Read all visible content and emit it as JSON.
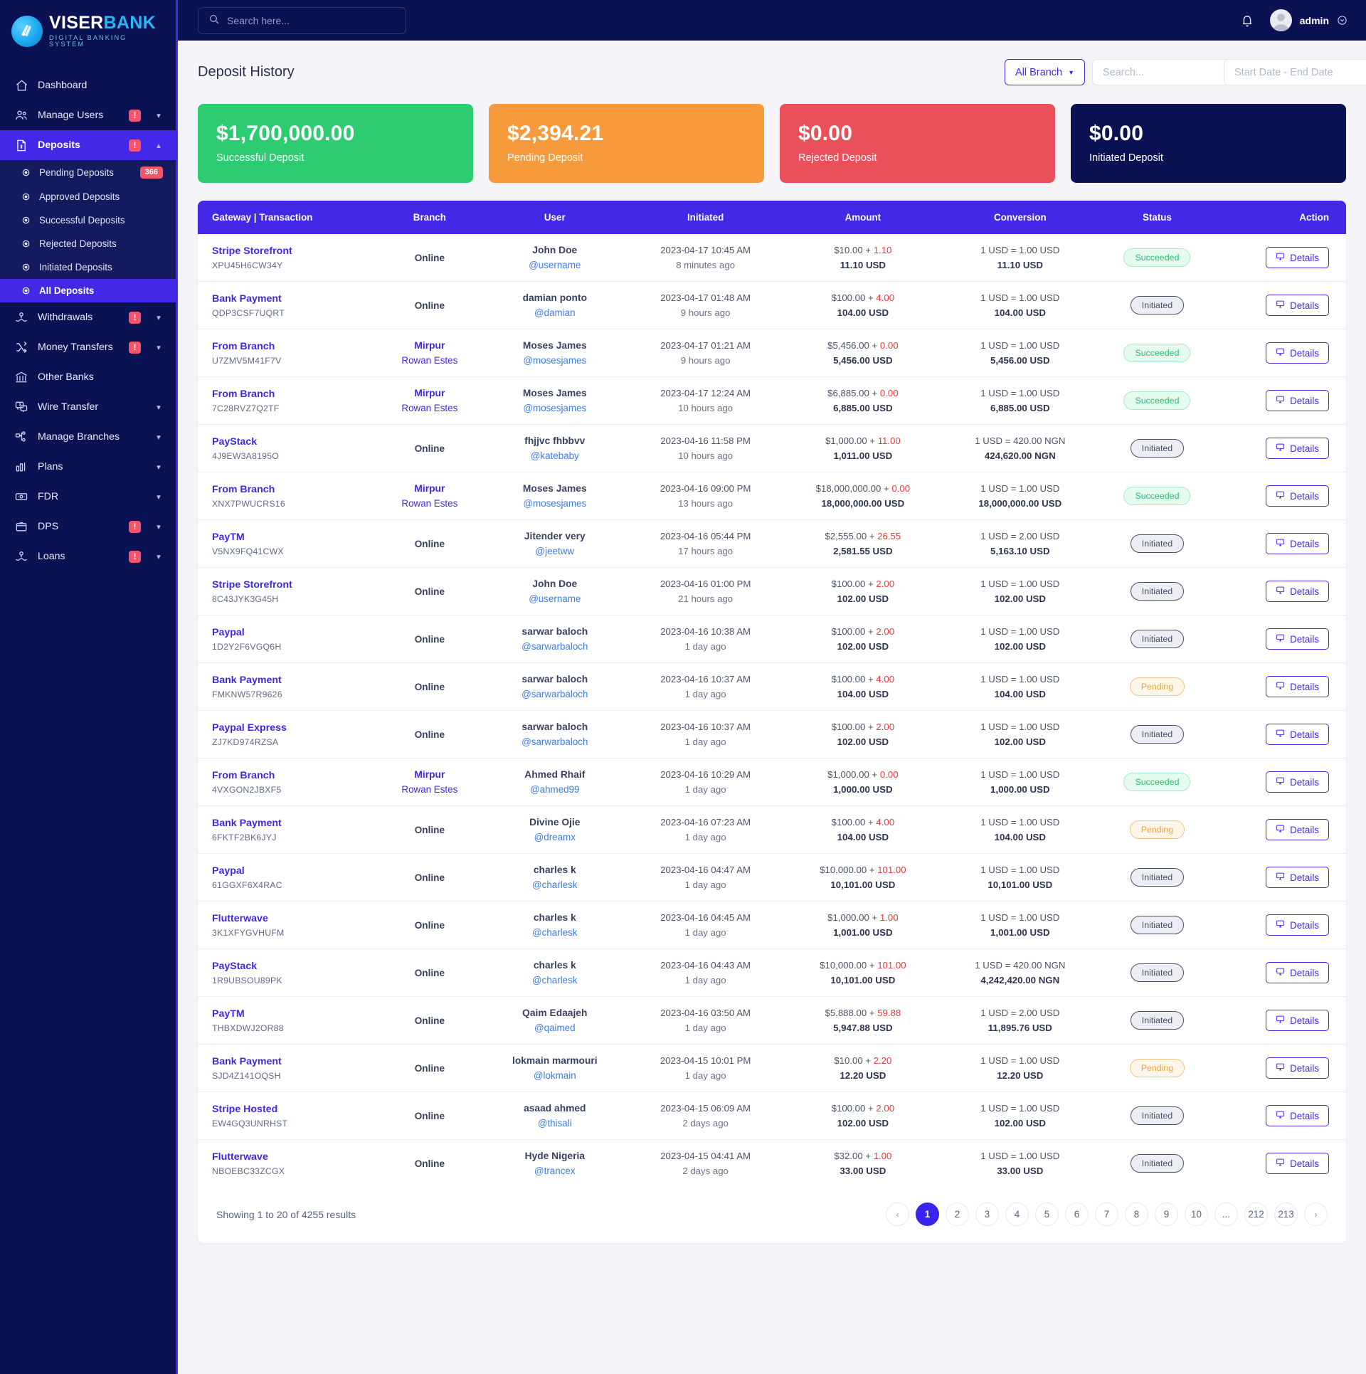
{
  "brand": {
    "word1": "VISER",
    "word2": "BANK",
    "subtitle": "DIGITAL BANKING SYSTEM"
  },
  "topbar": {
    "search_placeholder": "Search here...",
    "search_value": "",
    "username": "admin"
  },
  "sidebar": {
    "items": [
      {
        "label": "Dashboard",
        "icon": "home-icon",
        "alert": false,
        "chevron": ""
      },
      {
        "label": "Manage Users",
        "icon": "users-icon",
        "alert": true,
        "chevron": "down"
      },
      {
        "label": "Deposits",
        "icon": "deposit-icon",
        "alert": true,
        "chevron": "up",
        "active": true
      },
      {
        "label": "Withdrawals",
        "icon": "withdraw-icon",
        "alert": true,
        "chevron": "down"
      },
      {
        "label": "Money Transfers",
        "icon": "transfer-icon",
        "alert": true,
        "chevron": "down"
      },
      {
        "label": "Other Banks",
        "icon": "bank-icon",
        "alert": false,
        "chevron": ""
      },
      {
        "label": "Wire Transfer",
        "icon": "wire-icon",
        "alert": false,
        "chevron": "down"
      },
      {
        "label": "Manage Branches",
        "icon": "branch-icon",
        "alert": false,
        "chevron": "down"
      },
      {
        "label": "Plans",
        "icon": "plans-icon",
        "alert": false,
        "chevron": "down"
      },
      {
        "label": "FDR",
        "icon": "fdr-icon",
        "alert": false,
        "chevron": "down"
      },
      {
        "label": "DPS",
        "icon": "dps-icon",
        "alert": true,
        "chevron": "down"
      },
      {
        "label": "Loans",
        "icon": "loans-icon",
        "alert": true,
        "chevron": "down"
      }
    ],
    "subitems": [
      {
        "label": "Pending Deposits",
        "count": "366"
      },
      {
        "label": "Approved Deposits",
        "count": ""
      },
      {
        "label": "Successful Deposits",
        "count": ""
      },
      {
        "label": "Rejected Deposits",
        "count": ""
      },
      {
        "label": "Initiated Deposits",
        "count": ""
      },
      {
        "label": "All Deposits",
        "count": "",
        "active": true
      }
    ]
  },
  "page": {
    "title": "Deposit History",
    "branch_filter": "All Branch",
    "search_placeholder": "Search...",
    "search_value": "",
    "date_placeholder": "Start Date - End Date",
    "date_value": ""
  },
  "cards": [
    {
      "value": "$1,700,000.00",
      "label": "Successful Deposit",
      "color": "#2ecc71"
    },
    {
      "value": "$2,394.21",
      "label": "Pending Deposit",
      "color": "#f79a3c"
    },
    {
      "value": "$0.00",
      "label": "Rejected Deposit",
      "color": "#e9505a"
    },
    {
      "value": "$0.00",
      "label": "Initiated Deposit",
      "color": "#0a1253"
    }
  ],
  "table": {
    "columns": [
      "Gateway | Transaction",
      "Branch",
      "User",
      "Initiated",
      "Amount",
      "Conversion",
      "Status",
      "Action"
    ],
    "details_label": "Details",
    "rows": [
      {
        "gateway": "Stripe Storefront",
        "trx": "XPU45H6CW34Y",
        "branch": "Online",
        "branch_sub": "",
        "user": "John Doe",
        "handle": "@username",
        "date": "2023-04-17 10:45 AM",
        "ago": "8 minutes ago",
        "amount": "$10.00 + ",
        "fee": "1.10",
        "total": "11.10 USD",
        "rate": "1 USD = 1.00 USD",
        "converted": "11.10 USD",
        "status": "Succeeded"
      },
      {
        "gateway": "Bank Payment",
        "trx": "QDP3CSF7UQRT",
        "branch": "Online",
        "branch_sub": "",
        "user": "damian ponto",
        "handle": "@damian",
        "date": "2023-04-17 01:48 AM",
        "ago": "9 hours ago",
        "amount": "$100.00 + ",
        "fee": "4.00",
        "total": "104.00 USD",
        "rate": "1 USD = 1.00 USD",
        "converted": "104.00 USD",
        "status": "Initiated"
      },
      {
        "gateway": "From Branch",
        "trx": "U7ZMV5M41F7V",
        "branch": "Mirpur",
        "branch_sub": "Rowan Estes",
        "user": "Moses James",
        "handle": "@mosesjames",
        "date": "2023-04-17 01:21 AM",
        "ago": "9 hours ago",
        "amount": "$5,456.00 + ",
        "fee": "0.00",
        "total": "5,456.00 USD",
        "rate": "1 USD = 1.00 USD",
        "converted": "5,456.00 USD",
        "status": "Succeeded"
      },
      {
        "gateway": "From Branch",
        "trx": "7C28RVZ7Q2TF",
        "branch": "Mirpur",
        "branch_sub": "Rowan Estes",
        "user": "Moses James",
        "handle": "@mosesjames",
        "date": "2023-04-17 12:24 AM",
        "ago": "10 hours ago",
        "amount": "$6,885.00 + ",
        "fee": "0.00",
        "total": "6,885.00 USD",
        "rate": "1 USD = 1.00 USD",
        "converted": "6,885.00 USD",
        "status": "Succeeded"
      },
      {
        "gateway": "PayStack",
        "trx": "4J9EW3A8195O",
        "branch": "Online",
        "branch_sub": "",
        "user": "fhjjvc fhbbvv",
        "handle": "@katebaby",
        "date": "2023-04-16 11:58 PM",
        "ago": "10 hours ago",
        "amount": "$1,000.00 + ",
        "fee": "11.00",
        "total": "1,011.00 USD",
        "rate": "1 USD = 420.00 NGN",
        "converted": "424,620.00 NGN",
        "status": "Initiated"
      },
      {
        "gateway": "From Branch",
        "trx": "XNX7PWUCRS16",
        "branch": "Mirpur",
        "branch_sub": "Rowan Estes",
        "user": "Moses James",
        "handle": "@mosesjames",
        "date": "2023-04-16 09:00 PM",
        "ago": "13 hours ago",
        "amount": "$18,000,000.00 + ",
        "fee": "0.00",
        "total": "18,000,000.00 USD",
        "rate": "1 USD = 1.00 USD",
        "converted": "18,000,000.00 USD",
        "status": "Succeeded"
      },
      {
        "gateway": "PayTM",
        "trx": "V5NX9FQ41CWX",
        "branch": "Online",
        "branch_sub": "",
        "user": "Jitender very",
        "handle": "@jeetww",
        "date": "2023-04-16 05:44 PM",
        "ago": "17 hours ago",
        "amount": "$2,555.00 + ",
        "fee": "26.55",
        "total": "2,581.55 USD",
        "rate": "1 USD = 2.00 USD",
        "converted": "5,163.10 USD",
        "status": "Initiated"
      },
      {
        "gateway": "Stripe Storefront",
        "trx": "8C43JYK3G45H",
        "branch": "Online",
        "branch_sub": "",
        "user": "John Doe",
        "handle": "@username",
        "date": "2023-04-16 01:00 PM",
        "ago": "21 hours ago",
        "amount": "$100.00 + ",
        "fee": "2.00",
        "total": "102.00 USD",
        "rate": "1 USD = 1.00 USD",
        "converted": "102.00 USD",
        "status": "Initiated"
      },
      {
        "gateway": "Paypal",
        "trx": "1D2Y2F6VGQ6H",
        "branch": "Online",
        "branch_sub": "",
        "user": "sarwar baloch",
        "handle": "@sarwarbaloch",
        "date": "2023-04-16 10:38 AM",
        "ago": "1 day ago",
        "amount": "$100.00 + ",
        "fee": "2.00",
        "total": "102.00 USD",
        "rate": "1 USD = 1.00 USD",
        "converted": "102.00 USD",
        "status": "Initiated"
      },
      {
        "gateway": "Bank Payment",
        "trx": "FMKNW57R9626",
        "branch": "Online",
        "branch_sub": "",
        "user": "sarwar baloch",
        "handle": "@sarwarbaloch",
        "date": "2023-04-16 10:37 AM",
        "ago": "1 day ago",
        "amount": "$100.00 + ",
        "fee": "4.00",
        "total": "104.00 USD",
        "rate": "1 USD = 1.00 USD",
        "converted": "104.00 USD",
        "status": "Pending"
      },
      {
        "gateway": "Paypal Express",
        "trx": "ZJ7KD974RZSA",
        "branch": "Online",
        "branch_sub": "",
        "user": "sarwar baloch",
        "handle": "@sarwarbaloch",
        "date": "2023-04-16 10:37 AM",
        "ago": "1 day ago",
        "amount": "$100.00 + ",
        "fee": "2.00",
        "total": "102.00 USD",
        "rate": "1 USD = 1.00 USD",
        "converted": "102.00 USD",
        "status": "Initiated"
      },
      {
        "gateway": "From Branch",
        "trx": "4VXGON2JBXF5",
        "branch": "Mirpur",
        "branch_sub": "Rowan Estes",
        "user": "Ahmed Rhaif",
        "handle": "@ahmed99",
        "date": "2023-04-16 10:29 AM",
        "ago": "1 day ago",
        "amount": "$1,000.00 + ",
        "fee": "0.00",
        "total": "1,000.00 USD",
        "rate": "1 USD = 1.00 USD",
        "converted": "1,000.00 USD",
        "status": "Succeeded"
      },
      {
        "gateway": "Bank Payment",
        "trx": "6FKTF2BK6JYJ",
        "branch": "Online",
        "branch_sub": "",
        "user": "Divine Ojie",
        "handle": "@dreamx",
        "date": "2023-04-16 07:23 AM",
        "ago": "1 day ago",
        "amount": "$100.00 + ",
        "fee": "4.00",
        "total": "104.00 USD",
        "rate": "1 USD = 1.00 USD",
        "converted": "104.00 USD",
        "status": "Pending"
      },
      {
        "gateway": "Paypal",
        "trx": "61GGXF6X4RAC",
        "branch": "Online",
        "branch_sub": "",
        "user": "charles k",
        "handle": "@charlesk",
        "date": "2023-04-16 04:47 AM",
        "ago": "1 day ago",
        "amount": "$10,000.00 + ",
        "fee": "101.00",
        "total": "10,101.00 USD",
        "rate": "1 USD = 1.00 USD",
        "converted": "10,101.00 USD",
        "status": "Initiated"
      },
      {
        "gateway": "Flutterwave",
        "trx": "3K1XFYGVHUFM",
        "branch": "Online",
        "branch_sub": "",
        "user": "charles k",
        "handle": "@charlesk",
        "date": "2023-04-16 04:45 AM",
        "ago": "1 day ago",
        "amount": "$1,000.00 + ",
        "fee": "1.00",
        "total": "1,001.00 USD",
        "rate": "1 USD = 1.00 USD",
        "converted": "1,001.00 USD",
        "status": "Initiated"
      },
      {
        "gateway": "PayStack",
        "trx": "1R9UBSOU89PK",
        "branch": "Online",
        "branch_sub": "",
        "user": "charles k",
        "handle": "@charlesk",
        "date": "2023-04-16 04:43 AM",
        "ago": "1 day ago",
        "amount": "$10,000.00 + ",
        "fee": "101.00",
        "total": "10,101.00 USD",
        "rate": "1 USD = 420.00 NGN",
        "converted": "4,242,420.00 NGN",
        "status": "Initiated"
      },
      {
        "gateway": "PayTM",
        "trx": "THBXDWJ2OR88",
        "branch": "Online",
        "branch_sub": "",
        "user": "Qaim Edaajeh",
        "handle": "@qaimed",
        "date": "2023-04-16 03:50 AM",
        "ago": "1 day ago",
        "amount": "$5,888.00 + ",
        "fee": "59.88",
        "total": "5,947.88 USD",
        "rate": "1 USD = 2.00 USD",
        "converted": "11,895.76 USD",
        "status": "Initiated"
      },
      {
        "gateway": "Bank Payment",
        "trx": "SJD4Z141OQSH",
        "branch": "Online",
        "branch_sub": "",
        "user": "lokmain marmouri",
        "handle": "@lokmain",
        "date": "2023-04-15 10:01 PM",
        "ago": "1 day ago",
        "amount": "$10.00 + ",
        "fee": "2.20",
        "total": "12.20 USD",
        "rate": "1 USD = 1.00 USD",
        "converted": "12.20 USD",
        "status": "Pending"
      },
      {
        "gateway": "Stripe Hosted",
        "trx": "EW4GQ3UNRHST",
        "branch": "Online",
        "branch_sub": "",
        "user": "asaad ahmed",
        "handle": "@thisali",
        "date": "2023-04-15 06:09 AM",
        "ago": "2 days ago",
        "amount": "$100.00 + ",
        "fee": "2.00",
        "total": "102.00 USD",
        "rate": "1 USD = 1.00 USD",
        "converted": "102.00 USD",
        "status": "Initiated"
      },
      {
        "gateway": "Flutterwave",
        "trx": "NBOEBC33ZCGX",
        "branch": "Online",
        "branch_sub": "",
        "user": "Hyde Nigeria",
        "handle": "@trancex",
        "date": "2023-04-15 04:41 AM",
        "ago": "2 days ago",
        "amount": "$32.00 + ",
        "fee": "1.00",
        "total": "33.00 USD",
        "rate": "1 USD = 1.00 USD",
        "converted": "33.00 USD",
        "status": "Initiated"
      }
    ]
  },
  "footer": {
    "showing": "Showing 1 to 20 of 4255 results",
    "pages": [
      "‹",
      "1",
      "2",
      "3",
      "4",
      "5",
      "6",
      "7",
      "8",
      "9",
      "10",
      "...",
      "212",
      "213",
      "›"
    ],
    "active_page": "1"
  }
}
